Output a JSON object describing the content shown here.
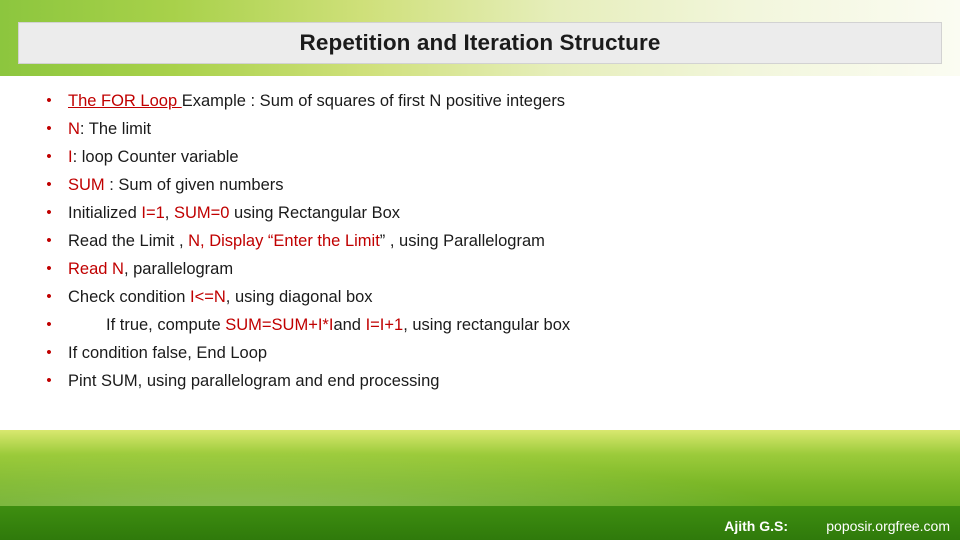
{
  "slide": {
    "title": "Repetition and Iteration Structure",
    "bullet_mark": "•",
    "bullets": [
      {
        "id": "for-loop-example",
        "parts": [
          {
            "text": "The FOR Loop ",
            "style": "red-underline"
          },
          {
            "text": "Example : Sum of squares of first N positive integers",
            "style": "plain"
          }
        ]
      },
      {
        "id": "limit",
        "parts": [
          {
            "text": "N",
            "style": "red"
          },
          {
            "text": ": The limit",
            "style": "plain"
          }
        ]
      },
      {
        "id": "loop-counter",
        "parts": [
          {
            "text": "I",
            "style": "red"
          },
          {
            "text": ": loop Counter variable",
            "style": "plain"
          }
        ]
      },
      {
        "id": "sum-definition",
        "parts": [
          {
            "text": "SUM",
            "style": "red"
          },
          {
            "text": " : Sum of given numbers",
            "style": "plain"
          }
        ]
      },
      {
        "id": "initialize",
        "parts": [
          {
            "text": "Initialized ",
            "style": "plain"
          },
          {
            "text": "I=1",
            "style": "red"
          },
          {
            "text": ", ",
            "style": "plain"
          },
          {
            "text": "SUM=0",
            "style": "red"
          },
          {
            "text": " using Rectangular Box",
            "style": "plain"
          }
        ]
      },
      {
        "id": "read-limit",
        "parts": [
          {
            "text": "Read the Limit , ",
            "style": "plain"
          },
          {
            "text": "N, Display “Enter the Limit",
            "style": "red"
          },
          {
            "text": "” , using Parallelogram",
            "style": "plain"
          }
        ]
      },
      {
        "id": "read-n",
        "parts": [
          {
            "text": "Read N",
            "style": "red"
          },
          {
            "text": ", parallelogram",
            "style": "plain"
          }
        ]
      },
      {
        "id": "check-condition",
        "parts": [
          {
            "text": "Check condition ",
            "style": "plain"
          },
          {
            "text": "I<=N",
            "style": "red"
          },
          {
            "text": ", using diagonal box",
            "style": "plain"
          }
        ]
      },
      {
        "id": "if-true",
        "indent": true,
        "parts": [
          {
            "text": "If true, compute ",
            "style": "plain"
          },
          {
            "text": "SUM=SUM+I*I",
            "style": "red"
          },
          {
            "text": "and ",
            "style": "plain"
          },
          {
            "text": "I=I+1",
            "style": "red"
          },
          {
            "text": ", using rectangular box",
            "style": "plain"
          }
        ]
      },
      {
        "id": "if-false",
        "parts": [
          {
            "text": "If condition false, End Loop",
            "style": "plain"
          }
        ]
      },
      {
        "id": "print-sum",
        "parts": [
          {
            "text": "Pint SUM, using parallelogram and  end processing",
            "style": "plain"
          }
        ]
      }
    ]
  },
  "footer": {
    "author": "Ajith G.S:",
    "site": "poposir.orgfree.com"
  },
  "colors": {
    "accent_red": "#c00000",
    "title_bg": "#ececec",
    "band_green": "#7cb828",
    "footer_bar": "#337f0c"
  }
}
